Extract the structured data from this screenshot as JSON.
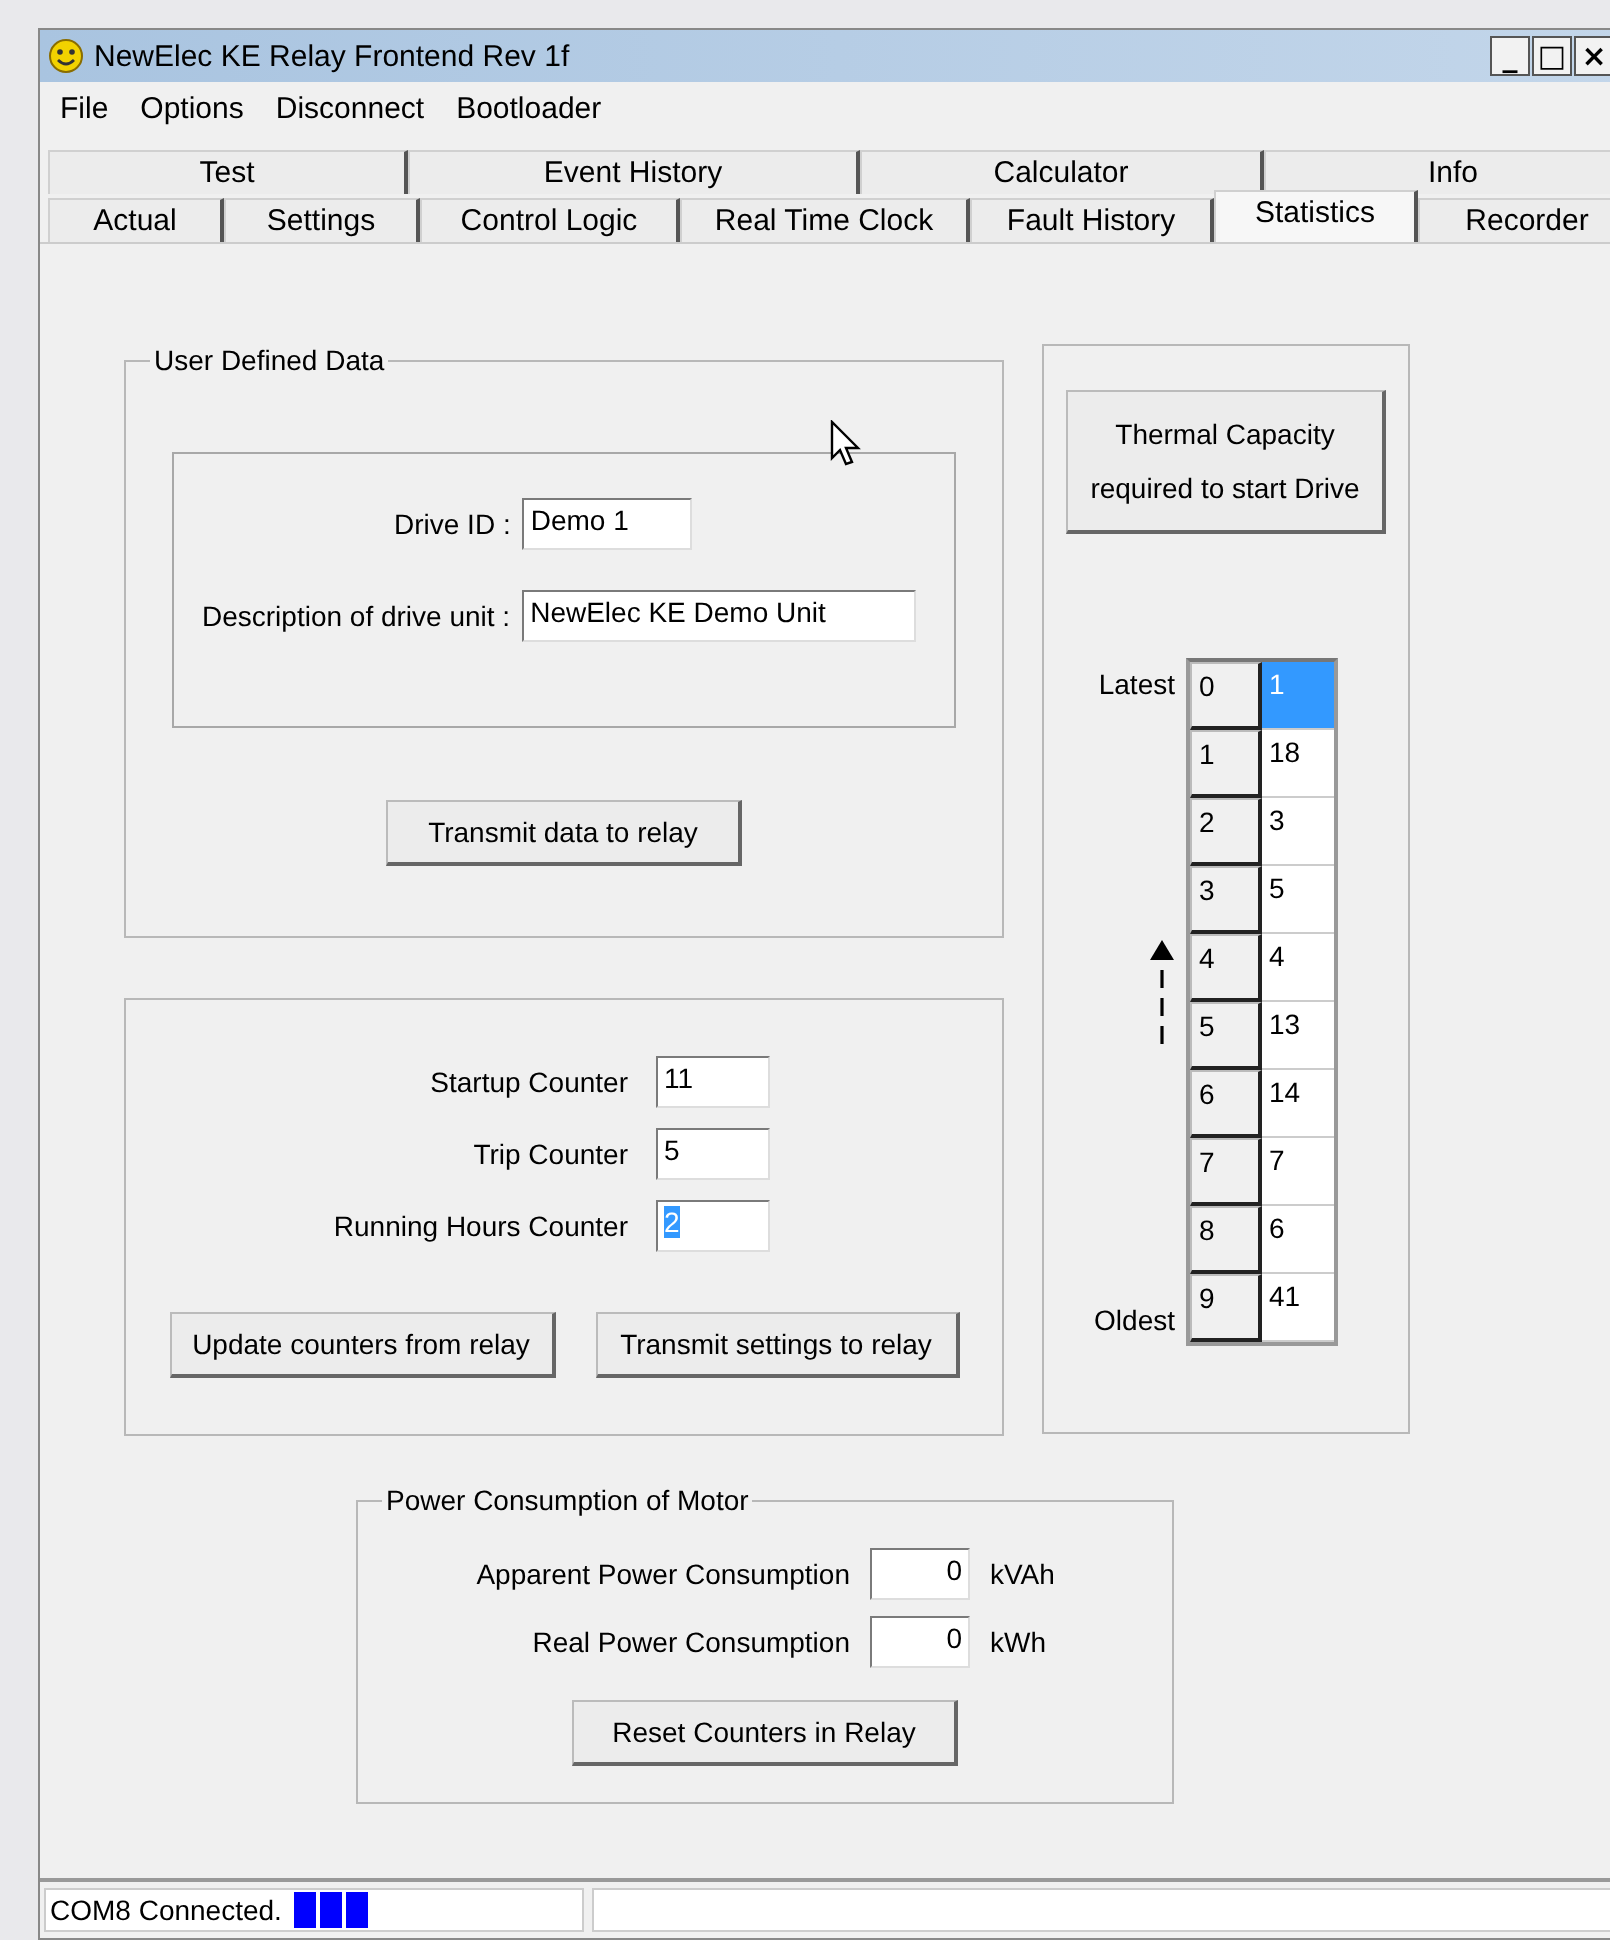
{
  "window": {
    "title": "NewElec KE Relay Frontend  Rev 1f",
    "controls": [
      "_",
      "□",
      "×"
    ]
  },
  "menu": [
    "File",
    "Options",
    "Disconnect",
    "Bootloader"
  ],
  "tabs_back": [
    {
      "label": "Test",
      "selected": false
    },
    {
      "label": "Event History",
      "selected": false
    },
    {
      "label": "Calculator",
      "selected": false
    },
    {
      "label": "Info",
      "selected": false
    }
  ],
  "tabs_front": [
    {
      "label": "Actual",
      "selected": false
    },
    {
      "label": "Settings",
      "selected": false
    },
    {
      "label": "Control Logic",
      "selected": false
    },
    {
      "label": "Real Time Clock",
      "selected": false
    },
    {
      "label": "Fault History",
      "selected": false
    },
    {
      "label": "Statistics",
      "selected": true
    },
    {
      "label": "Recorder",
      "selected": false
    }
  ],
  "user_defined_data": {
    "title": "User Defined Data",
    "fields": [
      {
        "label": "Drive ID :",
        "value": "Demo 1"
      },
      {
        "label": "Description of drive unit :",
        "value": "NewElec KE Demo Unit"
      }
    ],
    "button": "Transmit data to relay"
  },
  "counters": {
    "fields": [
      {
        "label": "Startup Counter",
        "value": "11",
        "selected": false
      },
      {
        "label": "Trip Counter",
        "value": "5",
        "selected": false
      },
      {
        "label": "Running Hours Counter",
        "value": "2",
        "selected": true
      }
    ],
    "buttons": [
      "Update counters from relay",
      "Transmit settings to relay"
    ]
  },
  "thermal": {
    "button": "Thermal Capacity required to start Drive",
    "latest_label": "Latest",
    "oldest_label": "Oldest",
    "rows": [
      {
        "index": "0",
        "value": "1",
        "selected": true
      },
      {
        "index": "1",
        "value": "18",
        "selected": false
      },
      {
        "index": "2",
        "value": "3",
        "selected": false
      },
      {
        "index": "3",
        "value": "5",
        "selected": false
      },
      {
        "index": "4",
        "value": "4",
        "selected": false
      },
      {
        "index": "5",
        "value": "13",
        "selected": false
      },
      {
        "index": "6",
        "value": "14",
        "selected": false
      },
      {
        "index": "7",
        "value": "7",
        "selected": false
      },
      {
        "index": "8",
        "value": "6",
        "selected": false
      },
      {
        "index": "9",
        "value": "41",
        "selected": false
      }
    ]
  },
  "power": {
    "title": "Power Consumption of Motor",
    "rows": [
      {
        "label": "Apparent Power Consumption",
        "value": "0",
        "unit": "kVAh"
      },
      {
        "label": "Real Power Consumption",
        "value": "0",
        "unit": "kWh"
      }
    ],
    "button": "Reset Counters in Relay"
  },
  "status_bar": {
    "text": "COM8 Connected."
  }
}
